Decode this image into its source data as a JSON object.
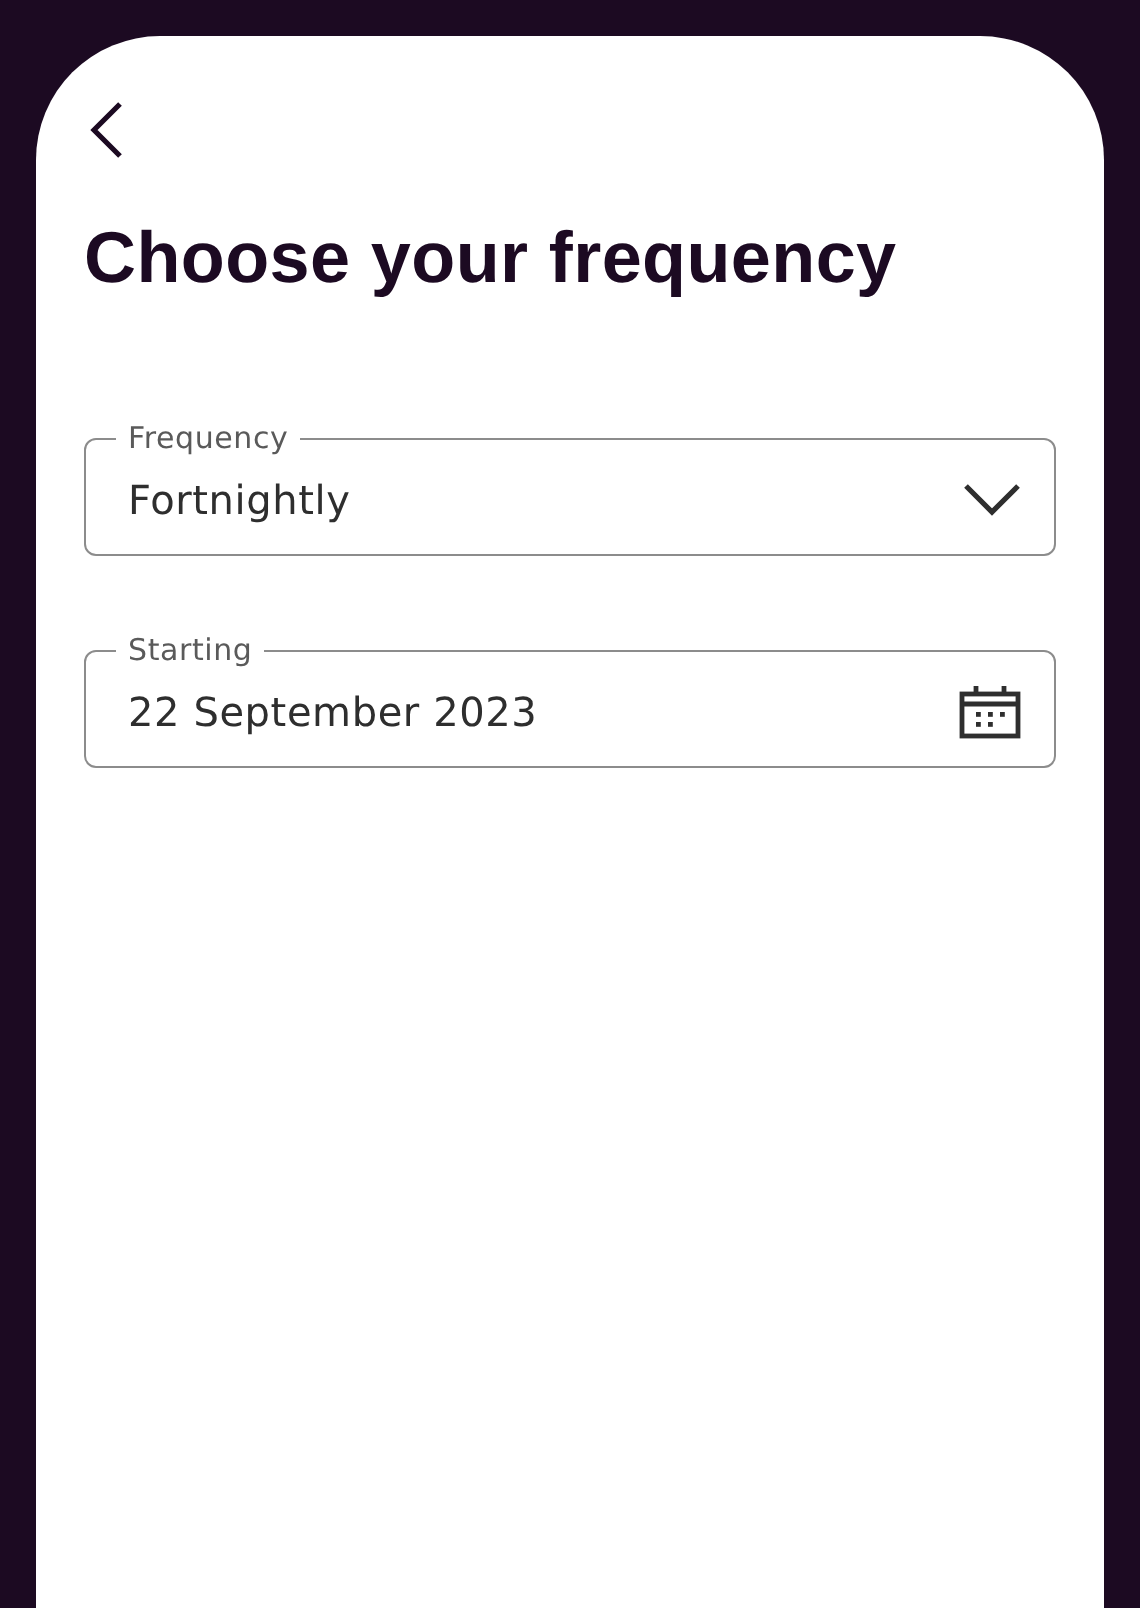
{
  "header": {
    "title": "Choose your frequency"
  },
  "fields": [
    {
      "kind": "select",
      "label": "Frequency",
      "value": "Fortnightly"
    },
    {
      "kind": "date",
      "label": "Starting",
      "value": "22 September 2023"
    }
  ]
}
